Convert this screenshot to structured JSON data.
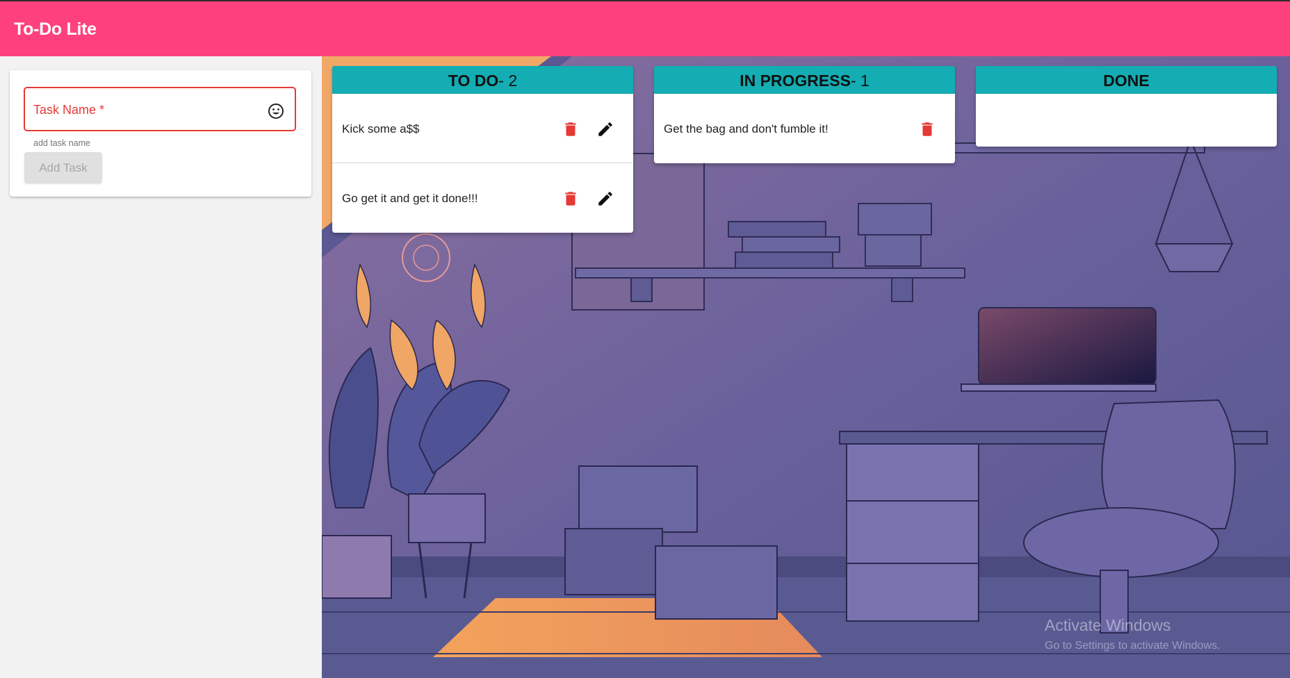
{
  "app": {
    "title": "To-Do Lite"
  },
  "form": {
    "input_label": "Task Name *",
    "helper_text": "add task name",
    "add_button": "Add Task"
  },
  "columns": [
    {
      "title": "TO DO",
      "count_suffix": "- 2",
      "tasks": [
        {
          "text": "Kick some a$$"
        },
        {
          "text": "Go get it and get it done!!!"
        }
      ]
    },
    {
      "title": "IN PROGRESS",
      "count_suffix": "- 1",
      "tasks": [
        {
          "text": "Get the bag and don't fumble it!"
        }
      ]
    },
    {
      "title": "DONE",
      "count_suffix": "",
      "tasks": []
    }
  ],
  "watermark": {
    "line1": "Activate Windows",
    "line2": "Go to Settings to activate Windows."
  },
  "colors": {
    "header_bar": "#fe417c",
    "column_header": "#13adb3",
    "error": "#e53935",
    "delete_icon": "#e53935"
  }
}
